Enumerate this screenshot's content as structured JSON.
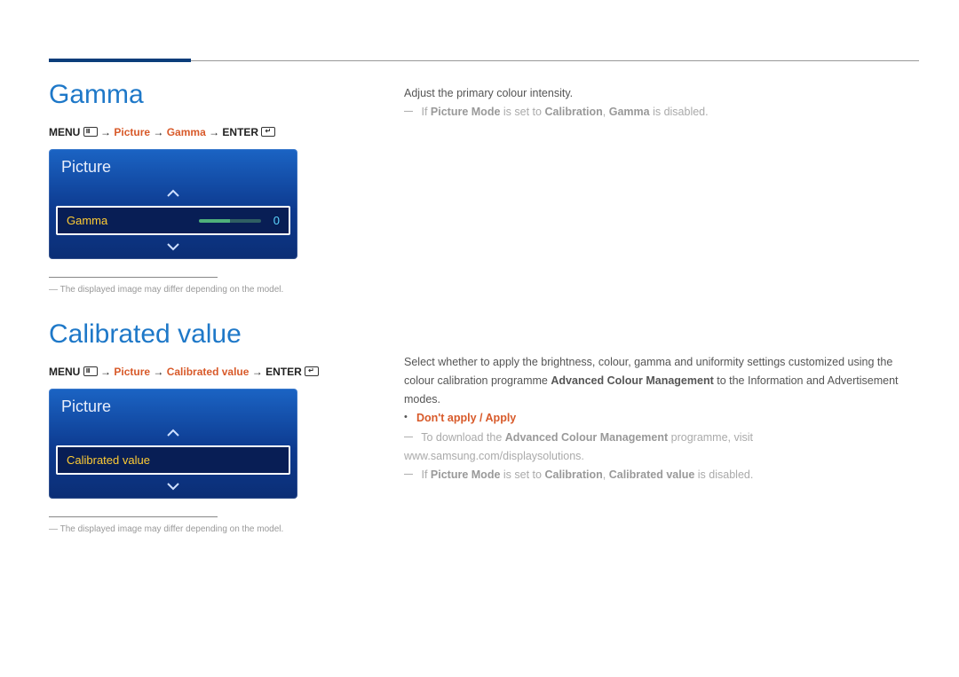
{
  "sections": {
    "gamma": {
      "heading": "Gamma",
      "nav": {
        "menu": "MENU",
        "steps": [
          "Picture",
          "Gamma"
        ],
        "enter": "ENTER"
      },
      "panel": {
        "title": "Picture",
        "item_label": "Gamma",
        "item_value": "0"
      },
      "footnote": "The displayed image may differ depending on the model.",
      "desc": "Adjust the primary colour intensity.",
      "note_prefix": "If",
      "note_pm": "Picture Mode",
      "note_mid": "is set to",
      "note_cal": "Calibration",
      "note_target": "Gamma",
      "note_suffix": "is disabled."
    },
    "calibrated": {
      "heading": "Calibrated value",
      "nav": {
        "menu": "MENU",
        "steps": [
          "Picture",
          "Calibrated value"
        ],
        "enter": "ENTER"
      },
      "panel": {
        "title": "Picture",
        "item_label": "Calibrated value"
      },
      "footnote": "The displayed image may differ depending on the model.",
      "desc": "Select whether to apply the brightness, colour, gamma and uniformity settings customized using the colour calibration programme",
      "desc_bold": "Advanced Colour Management",
      "desc_tail": "to the Information and Advertisement modes.",
      "options": {
        "a": "Don't apply",
        "b": "Apply"
      },
      "download_pre": "To download the",
      "download_bold": "Advanced Colour Management",
      "download_tail": "programme, visit www.samsung.com/displaysolutions.",
      "note_prefix": "If",
      "note_pm": "Picture Mode",
      "note_mid": "is set to",
      "note_cal": "Calibration",
      "note_target": "Calibrated value",
      "note_suffix": "is disabled."
    }
  }
}
